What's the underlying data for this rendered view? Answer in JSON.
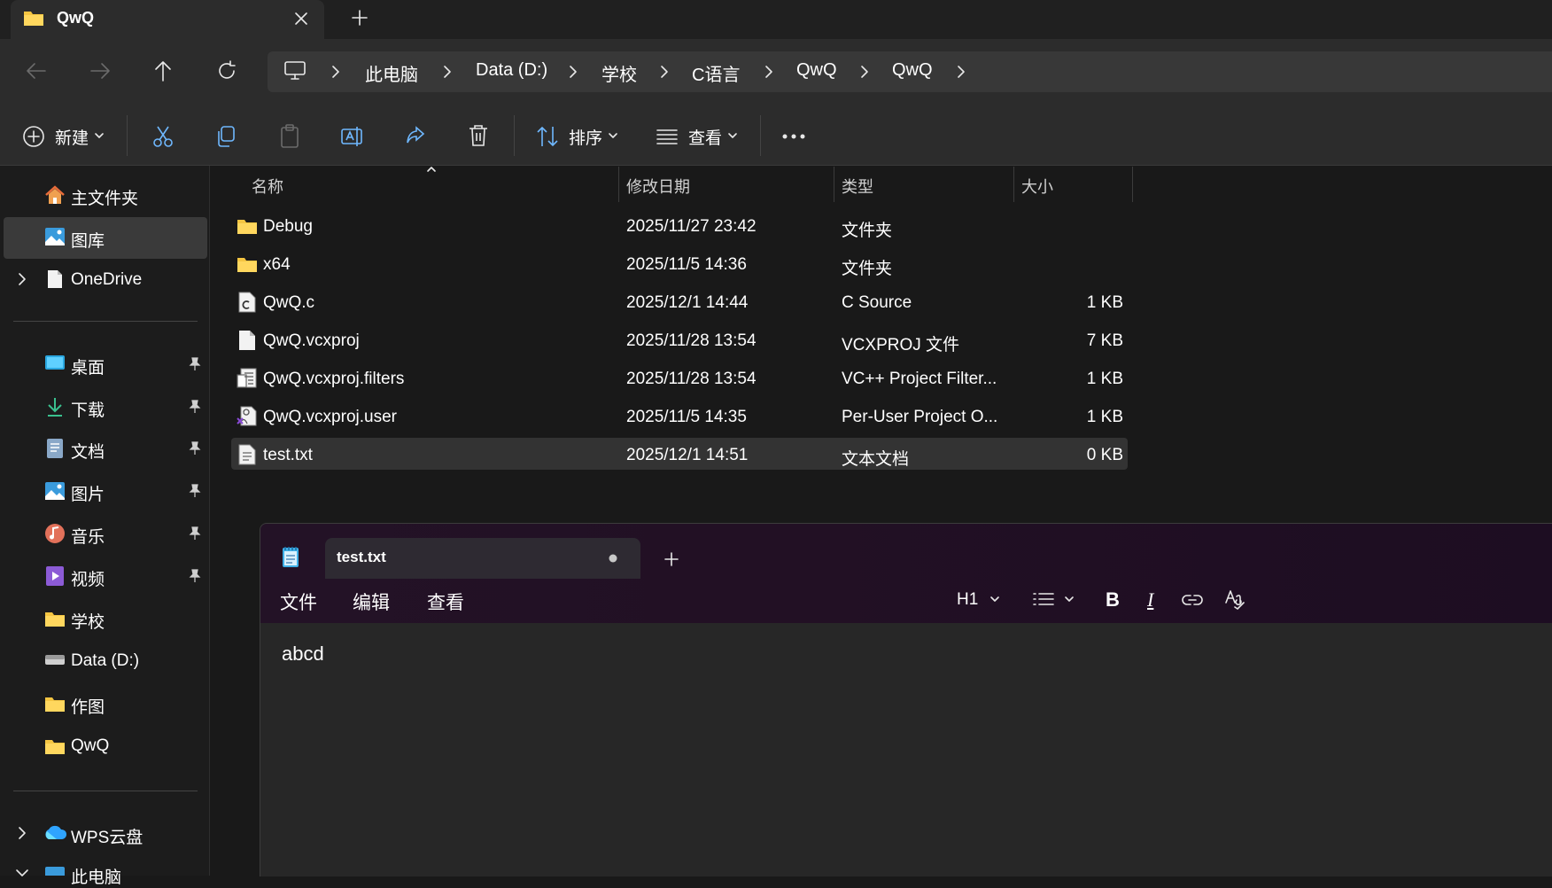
{
  "window": {
    "tab_title": "QwQ"
  },
  "address": {
    "crumbs": [
      "此电脑",
      "Data (D:)",
      "学校",
      "C语言",
      "QwQ",
      "QwQ"
    ]
  },
  "toolbar": {
    "new_label": "新建",
    "sort_label": "排序",
    "view_label": "查看"
  },
  "sidebar": {
    "home": "主文件夹",
    "gallery": "图库",
    "onedrive": "OneDrive",
    "quick": [
      "桌面",
      "下载",
      "文档",
      "图片",
      "音乐",
      "视频",
      "学校",
      "Data (D:)",
      "作图",
      "QwQ"
    ],
    "wps": "WPS云盘",
    "thispc": "此电脑"
  },
  "columns": {
    "name": "名称",
    "date": "修改日期",
    "type": "类型",
    "size": "大小"
  },
  "files": [
    {
      "name": "Debug",
      "date": "2025/11/27 23:42",
      "type": "文件夹",
      "size": "",
      "icon": "folder-icon"
    },
    {
      "name": "x64",
      "date": "2025/11/5 14:36",
      "type": "文件夹",
      "size": "",
      "icon": "folder-icon"
    },
    {
      "name": "QwQ.c",
      "date": "2025/12/1 14:44",
      "type": "C Source",
      "size": "1 KB",
      "icon": "c-source-icon"
    },
    {
      "name": "QwQ.vcxproj",
      "date": "2025/11/28 13:54",
      "type": "VCXPROJ 文件",
      "size": "7 KB",
      "icon": "file-icon"
    },
    {
      "name": "QwQ.vcxproj.filters",
      "date": "2025/11/28 13:54",
      "type": "VC++ Project Filter...",
      "size": "1 KB",
      "icon": "filters-icon"
    },
    {
      "name": "QwQ.vcxproj.user",
      "date": "2025/11/5 14:35",
      "type": "Per-User Project O...",
      "size": "1 KB",
      "icon": "vs-user-icon"
    },
    {
      "name": "test.txt",
      "date": "2025/12/1 14:51",
      "type": "文本文档",
      "size": "0 KB",
      "icon": "text-file-icon"
    }
  ],
  "notepad": {
    "tab_title": "test.txt",
    "menu": [
      "文件",
      "编辑",
      "查看"
    ],
    "heading_label": "H1",
    "content": "abcd"
  },
  "colors": {
    "folder": "#f5c542",
    "notepad_header": "#231226",
    "selection": "#3a3a3a"
  }
}
